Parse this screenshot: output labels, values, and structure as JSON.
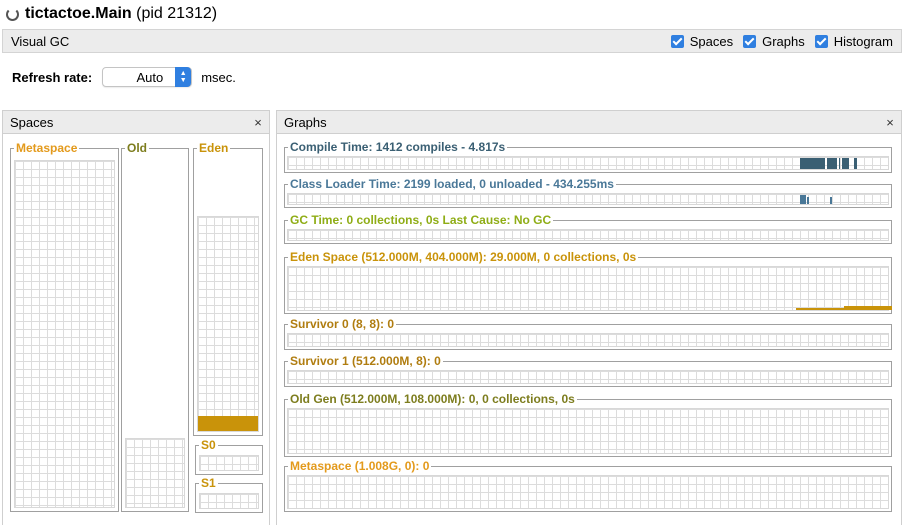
{
  "window": {
    "title_main": "tictactoe.Main",
    "title_pid": "(pid 21312)"
  },
  "visual_gc": {
    "title": "Visual GC",
    "toggles": [
      {
        "label": "Spaces",
        "checked": true
      },
      {
        "label": "Graphs",
        "checked": true
      },
      {
        "label": "Histogram",
        "checked": true
      }
    ]
  },
  "refresh": {
    "label": "Refresh rate:",
    "value": "Auto",
    "unit": "msec."
  },
  "spaces_panel": {
    "title": "Spaces",
    "close": "×",
    "metaspace": {
      "label": "Metaspace",
      "color": "#e39a1c"
    },
    "old": {
      "label": "Old",
      "color": "#7d7d1e",
      "used_fraction": 0.0
    },
    "eden": {
      "label": "Eden",
      "color": "#c9930a",
      "used_fraction": 0.07
    },
    "s0": {
      "label": "S0",
      "color": "#c9930a"
    },
    "s1": {
      "label": "S1",
      "color": "#c9930a"
    }
  },
  "graphs_panel": {
    "title": "Graphs",
    "close": "×",
    "graphs": [
      {
        "label": "Compile Time: 1412 compiles - 4.817s",
        "color": "#3a5f73"
      },
      {
        "label": "Class Loader Time: 2199 loaded, 0 unloaded - 434.255ms",
        "color": "#4a7898"
      },
      {
        "label": "GC Time: 0 collections, 0s Last Cause: No GC",
        "color": "#8fad16"
      },
      {
        "label": "Eden Space (512.000M, 404.000M): 29.000M, 0 collections, 0s",
        "color": "#c9930a"
      },
      {
        "label": "Survivor 0 (8, 8): 0",
        "color": "#b07d10"
      },
      {
        "label": "Survivor 1 (512.000M, 8): 0",
        "color": "#b07d10"
      },
      {
        "label": "Old Gen (512.000M, 108.000M): 0, 0 collections, 0s",
        "color": "#7d7d1e"
      },
      {
        "label": "Metaspace (1.008G, 0): 0",
        "color": "#e39a1c"
      }
    ]
  }
}
